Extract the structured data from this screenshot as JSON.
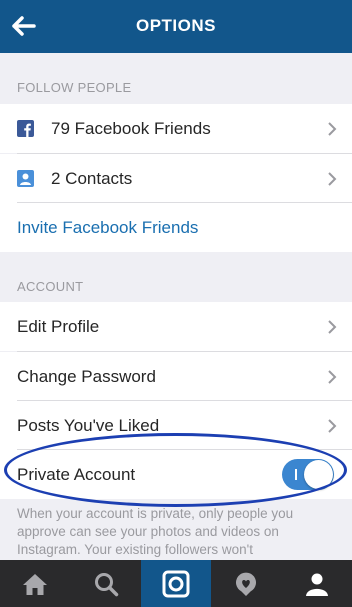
{
  "header": {
    "title": "OPTIONS"
  },
  "sections": {
    "follow": {
      "label": "FOLLOW PEOPLE",
      "items": [
        {
          "label": "79 Facebook Friends",
          "icon": "facebook-icon"
        },
        {
          "label": "2 Contacts",
          "icon": "contacts-icon"
        }
      ],
      "link": "Invite Facebook Friends"
    },
    "account": {
      "label": "ACCOUNT",
      "items": [
        {
          "label": "Edit Profile"
        },
        {
          "label": "Change Password"
        },
        {
          "label": "Posts You've Liked"
        }
      ],
      "private": {
        "label": "Private Account",
        "on": true
      }
    }
  },
  "help_text": "When your account is private, only people you approve can see your photos and videos on Instagram. Your existing followers won't",
  "tabbar": {
    "tabs": [
      {
        "name": "home-icon"
      },
      {
        "name": "search-icon"
      },
      {
        "name": "camera-icon",
        "active": true
      },
      {
        "name": "activity-icon"
      },
      {
        "name": "profile-icon"
      }
    ]
  },
  "colors": {
    "header": "#12568b",
    "link": "#1a6fb0",
    "toggle": "#3b86d0",
    "annotation": "#1c3fb2"
  }
}
